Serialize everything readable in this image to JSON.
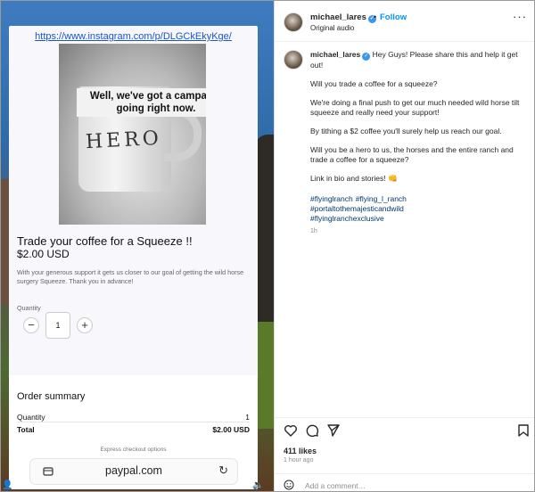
{
  "video": {
    "url": "https://www.instagram.com/p/DLGCkEkyKge/",
    "image_caption": "Well, we've got a campaign going right now.",
    "mug_text": "HERO",
    "product": {
      "title": "Trade your coffee for a Squeeze !!",
      "price": "$2.00 USD",
      "description": "With your generous support it gets us closer to our goal of getting the wild horse surgery Squeeze. Thank you in advance!",
      "quantity_label": "Quantity",
      "quantity_value": "1",
      "minus_symbol": "−",
      "plus_symbol": "+"
    },
    "summary": {
      "title": "Order summary",
      "quantity_label": "Quantity",
      "quantity_value": "1",
      "total_label": "Total",
      "total_value": "$2.00 USD",
      "express_text": "Express checkout options"
    },
    "browser": {
      "url": "paypal.com"
    }
  },
  "post": {
    "username": "michael_lares",
    "dot": "•",
    "follow": "Follow",
    "audio": "Original audio",
    "more": "···",
    "caption": {
      "username": "michael_lares",
      "lines": [
        "Hey Guys! Please share this and help it get out!",
        "Will you trade a coffee for a squeeze?",
        "We're doing a final push to get our much needed wild horse tilt squeeze and really need your support!",
        "By tithing a $2 coffee you'll surely help us reach our goal.",
        "Will you be a hero to us, the horses and the entire ranch and trade a coffee for a squeeze?",
        "Link in bio and stories! 👊"
      ],
      "hashtags": [
        "#flyinglranch",
        "#flying_l_ranch",
        "#portaltothemajesticandwild",
        "#flyinglranchexclusive"
      ],
      "time": "1h"
    },
    "likes": "411 likes",
    "ago": "1 hour ago",
    "comment_placeholder": "Add a comment…",
    "icons": {
      "like": "heart-icon",
      "comment": "comment-icon",
      "share": "share-icon",
      "save": "bookmark-icon",
      "emoji": "emoji-icon"
    },
    "accent": "#0095f6",
    "hashtag_color": "#00376b"
  }
}
